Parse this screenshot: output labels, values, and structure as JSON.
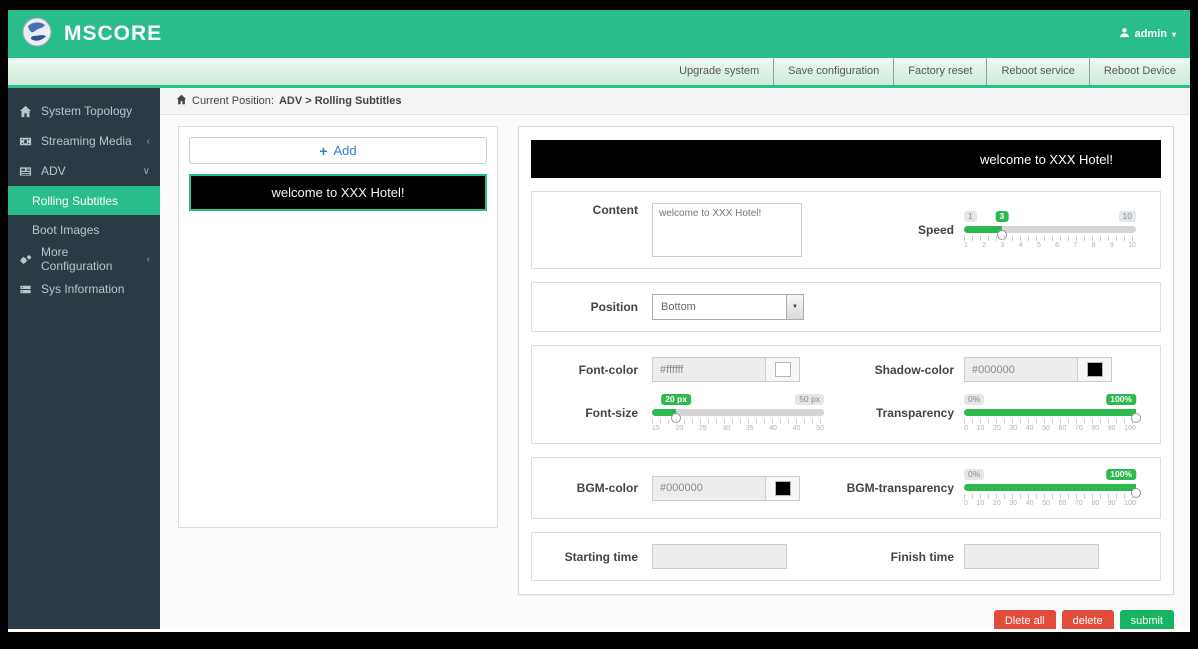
{
  "header": {
    "brand": "MSCORE",
    "user": "admin",
    "links": [
      "Upgrade system",
      "Save configuration",
      "Factory reset",
      "Reboot service",
      "Reboot Device"
    ]
  },
  "sidebar": {
    "items": [
      {
        "label": "System Topology"
      },
      {
        "label": "Streaming Media"
      },
      {
        "label": "ADV"
      },
      {
        "label": "More Configuration"
      },
      {
        "label": "Sys Information"
      }
    ],
    "adv_children": [
      {
        "label": "Rolling Subtitles"
      },
      {
        "label": "Boot Images"
      }
    ]
  },
  "breadcrumb": {
    "prefix": "Current Position:",
    "path": "ADV > Rolling Subtitles"
  },
  "list_panel": {
    "add_label": "Add",
    "items": [
      "welcome to XXX Hotel!"
    ]
  },
  "preview": {
    "text": "welcome to XXX Hotel!"
  },
  "form": {
    "content": {
      "label": "Content",
      "value": "welcome to XXX Hotel!"
    },
    "speed": {
      "label": "Speed",
      "value": "3",
      "min": "1",
      "max": "10",
      "percent": "22%",
      "ticks": [
        "1",
        "2",
        "3",
        "4",
        "5",
        "6",
        "7",
        "8",
        "9",
        "10"
      ]
    },
    "position": {
      "label": "Position",
      "value": "Bottom"
    },
    "font_color": {
      "label": "Font-color",
      "value": "#ffffff",
      "swatch": "#ffffff"
    },
    "shadow_color": {
      "label": "Shadow-color",
      "value": "#000000",
      "swatch": "#000000"
    },
    "font_size": {
      "label": "Font-size",
      "value": "20 px",
      "max": "50 px",
      "percent": "14%",
      "ticks": [
        "15",
        "20",
        "25",
        "30",
        "35",
        "40",
        "45",
        "50"
      ]
    },
    "transparency": {
      "label": "Transparency",
      "value": "100%",
      "min": "0%",
      "percent": "100%",
      "ticks": [
        "0",
        "10",
        "20",
        "30",
        "40",
        "50",
        "60",
        "70",
        "80",
        "90",
        "100"
      ]
    },
    "bgm_color": {
      "label": "BGM-color",
      "value": "#000000",
      "swatch": "#000000"
    },
    "bgm_transparency": {
      "label": "BGM-transparency",
      "value": "100%",
      "min": "0%",
      "percent": "100%",
      "ticks": [
        "0",
        "10",
        "20",
        "30",
        "40",
        "50",
        "60",
        "70",
        "80",
        "90",
        "100"
      ]
    },
    "starting_time": {
      "label": "Starting time",
      "value": ""
    },
    "finish_time": {
      "label": "Finish time",
      "value": ""
    }
  },
  "actions": {
    "delete_all": "Dlete all",
    "delete": "delete",
    "submit": "submit"
  },
  "icons": {
    "plus": "+",
    "caret_down": "▾",
    "chevron_left": "‹",
    "chevron_down": "∨",
    "select_arrow": "▼"
  },
  "colors": {
    "brand_green": "#2abd8c",
    "slider_green": "#2eb850",
    "danger_red": "#e14c3c",
    "success_green": "#16b462",
    "sidebar_bg": "#2b3a45",
    "font_color_value": "#ffffff",
    "shadow_color_value": "#000000",
    "bgm_color_value": "#000000"
  }
}
